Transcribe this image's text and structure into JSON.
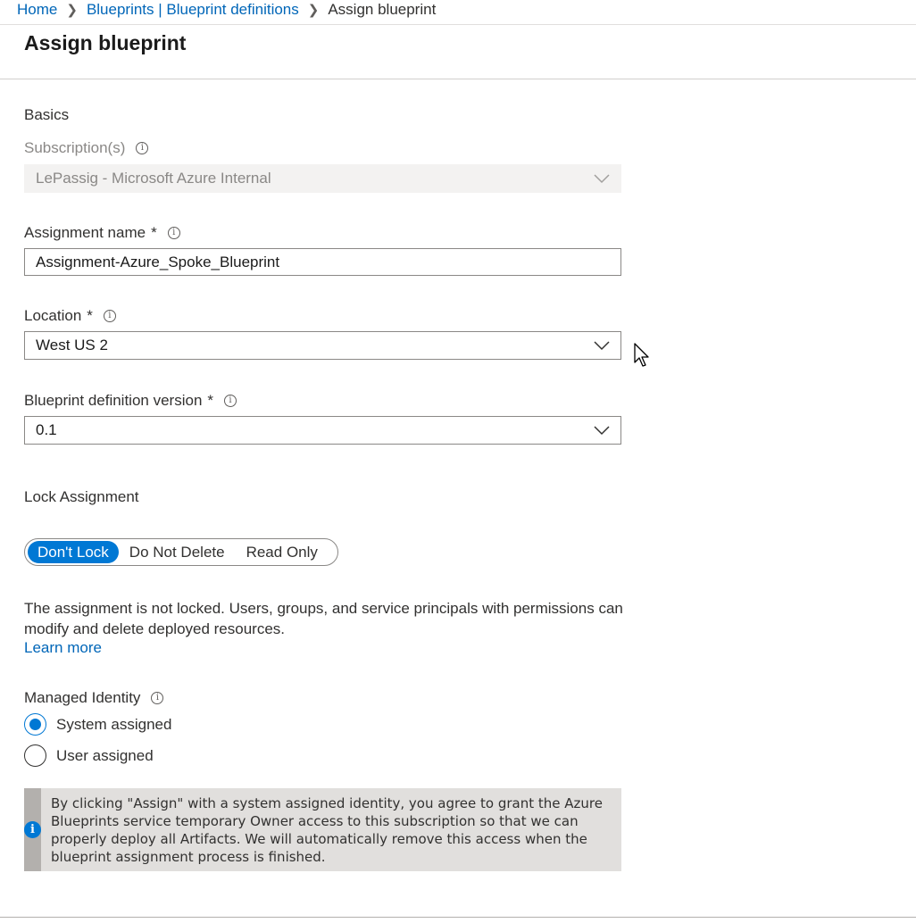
{
  "breadcrumb": {
    "items": [
      "Home",
      "Blueprints | Blueprint definitions"
    ],
    "current": "Assign blueprint"
  },
  "page": {
    "title": "Assign blueprint"
  },
  "basics": {
    "section_label": "Basics",
    "subscription": {
      "label": "Subscription(s)",
      "value": "LePassig - Microsoft Azure Internal",
      "disabled": true
    },
    "assignment_name": {
      "label": "Assignment name",
      "required_mark": "*",
      "value": "Assignment-Azure_Spoke_Blueprint"
    },
    "location": {
      "label": "Location",
      "required_mark": "*",
      "value": "West US 2"
    },
    "version": {
      "label": "Blueprint definition version",
      "required_mark": "*",
      "value": "0.1"
    }
  },
  "lock": {
    "section_label": "Lock Assignment",
    "options": [
      "Don't Lock",
      "Do Not Delete",
      "Read Only"
    ],
    "selected": "Don't Lock",
    "description": "The assignment is not locked. Users, groups, and service principals with permissions can modify and delete deployed resources.",
    "learn_more": "Learn more"
  },
  "identity": {
    "label": "Managed Identity",
    "options": [
      {
        "label": "System assigned",
        "checked": true
      },
      {
        "label": "User assigned",
        "checked": false
      }
    ],
    "notice": "By clicking \"Assign\" with a system assigned identity, you agree to grant the Azure Blueprints service temporary Owner access to this subscription so that we can properly deploy all Artifacts. We will automatically remove this access when the blueprint assignment process is finished."
  },
  "colors": {
    "accent": "#0078d4",
    "link": "#0066b8",
    "disabled_bg": "#f3f2f1",
    "notice_bg": "#e1dfdd"
  },
  "icons": {
    "info": "info-icon",
    "chevron": "chevron-down-icon",
    "breadcrumb_separator": "chevron-right-icon",
    "cursor": "mouse-pointer-icon"
  }
}
